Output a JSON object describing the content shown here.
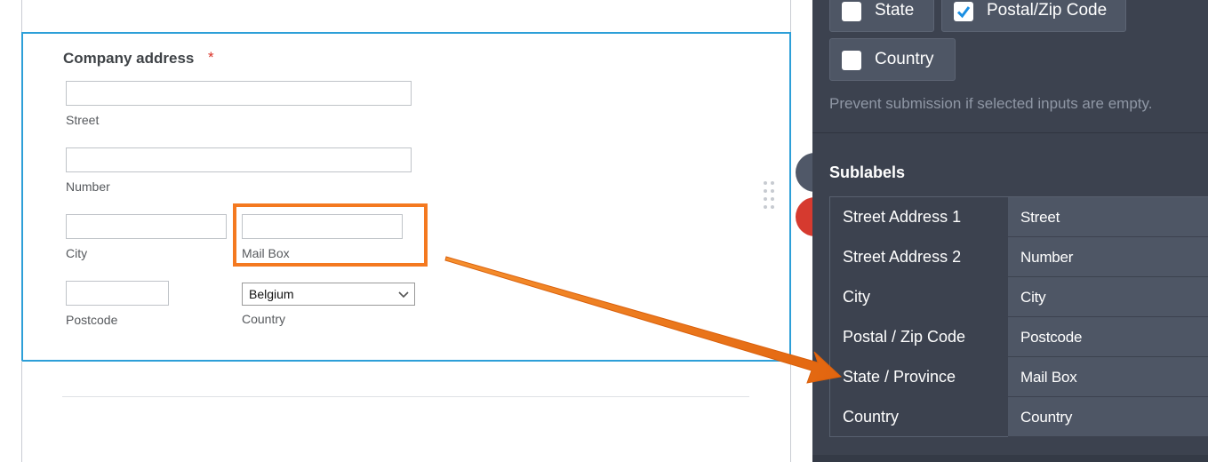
{
  "form": {
    "field_label": "Company address",
    "required_marker": "*",
    "inputs": [
      {
        "sublabel": "Street",
        "value": ""
      },
      {
        "sublabel": "Number",
        "value": ""
      },
      {
        "sublabel": "City",
        "value": ""
      },
      {
        "sublabel": "Mail Box",
        "value": ""
      },
      {
        "sublabel": "Postcode",
        "value": ""
      }
    ],
    "country": {
      "sublabel": "Country",
      "selected": "Belgium"
    }
  },
  "panel": {
    "checkboxes": [
      {
        "label": "State",
        "checked": false
      },
      {
        "label": "Postal/Zip Code",
        "checked": true
      },
      {
        "label": "Country",
        "checked": false
      }
    ],
    "required_hint": "Prevent submission if selected inputs are empty.",
    "sublabels_title": "Sublabels",
    "sublabels": [
      {
        "key": "Street Address 1",
        "value": "Street"
      },
      {
        "key": "Street Address 2",
        "value": "Number"
      },
      {
        "key": "City",
        "value": "City"
      },
      {
        "key": "Postal / Zip Code",
        "value": "Postcode"
      },
      {
        "key": "State / Province",
        "value": "Mail Box"
      },
      {
        "key": "Country",
        "value": "Country"
      }
    ]
  },
  "colors": {
    "highlight": "#f47920",
    "selection_border": "#2d9fd8",
    "panel_bg": "#3c424f",
    "required": "#d93025"
  }
}
